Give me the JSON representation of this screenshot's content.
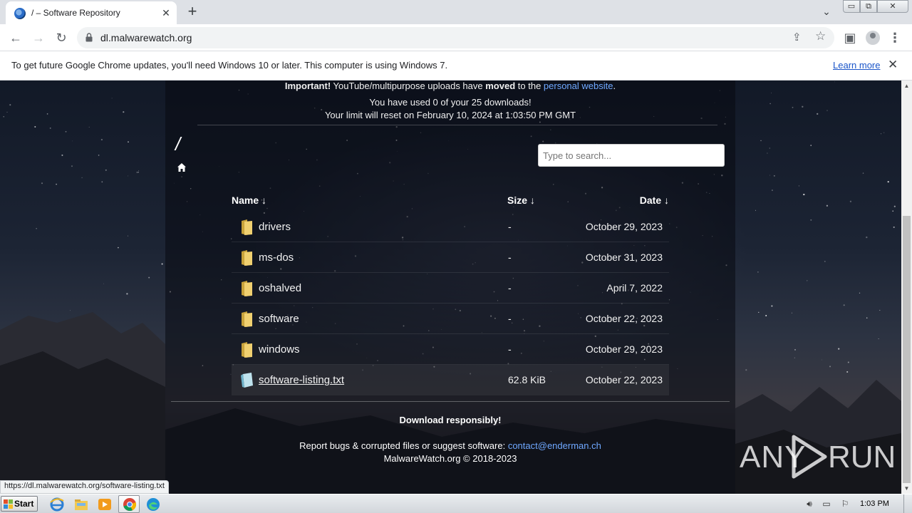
{
  "browser": {
    "tab_title": "/ – Software Repository",
    "tab_close": "✕",
    "new_tab": "+",
    "tab_search": "⌄",
    "window_minimize": "▭",
    "window_restore": "⧉",
    "window_close": "✕",
    "back": "←",
    "forward": "→",
    "reload": "↻",
    "url": "dl.malwarewatch.org",
    "share": "⇪",
    "bookmark": "☆",
    "side_panel": "▣",
    "menu": "⋮"
  },
  "infobar": {
    "message": "To get future Google Chrome updates, you'll need Windows 10 or later. This computer is using Windows 7.",
    "learn_more": "Learn more",
    "close": "✕"
  },
  "page": {
    "notice_important": "Important!",
    "notice_text": " YouTube/multipurpose uploads have ",
    "notice_moved": "moved",
    "notice_to": " to the ",
    "notice_link": "personal website",
    "notice_end": ".",
    "downloads_used": "You have used 0 of your 25 downloads!",
    "limit_reset": "Your limit will reset on February 10, 2024 at 1:03:50 PM GMT",
    "path": "/",
    "search_placeholder": "Type to search...",
    "columns": {
      "name": "Name ↓",
      "size": "Size ↓",
      "date": "Date ↓"
    },
    "rows": [
      {
        "name": "drivers",
        "size": "-",
        "date": "October 29, 2023",
        "type": "folder"
      },
      {
        "name": "ms-dos",
        "size": "-",
        "date": "October 31, 2023",
        "type": "folder"
      },
      {
        "name": "oshalved",
        "size": "-",
        "date": "April 7, 2022",
        "type": "folder"
      },
      {
        "name": "software",
        "size": "-",
        "date": "October 22, 2023",
        "type": "folder"
      },
      {
        "name": "windows",
        "size": "-",
        "date": "October 29, 2023",
        "type": "folder"
      },
      {
        "name": "software-listing.txt",
        "size": "62.8 KiB",
        "date": "October 22, 2023",
        "type": "file"
      }
    ],
    "footer_responsibly": "Download responsibly!",
    "footer_report": "Report bugs & corrupted files or suggest software: ",
    "footer_email": "contact@enderman.ch",
    "footer_copyright": "MalwareWatch.org © 2018-2023",
    "status_url": "https://dl.malwarewatch.org/software-listing.txt"
  },
  "watermark": {
    "left": "ANY",
    "right": "RUN"
  },
  "taskbar": {
    "start": "Start",
    "time": "1:03 PM"
  },
  "colors": {
    "link": "#6fa8ff",
    "chrome_link": "#1a55c9",
    "folder": "#e8c45a"
  }
}
